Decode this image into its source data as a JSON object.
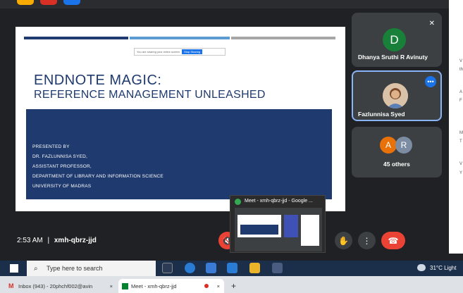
{
  "slide": {
    "share_text": "You are sharing your entire screen",
    "stop_label": "Stop Sharing",
    "title_line1": "ENDNOTE MAGIC:",
    "title_line2": "REFERENCE MANAGEMENT UNLEASHED",
    "presented_by": "PRESENTED BY",
    "presenter": "DR. FAZLUNNISA SYED,",
    "role": "ASSISTANT PROFESSOR,",
    "department": "DEPARTMENT OF LIBRARY AND INFORMATION SCIENCE",
    "university": "UNIVERSITY OF MADRAS"
  },
  "participants": {
    "p1_initial": "D",
    "p1_name": "Dhanya Sruthi R Avinuty",
    "p2_name": "Fazlunnisa Syed",
    "others_a": "A",
    "others_r": "R",
    "others_label": "45 others"
  },
  "side_panel_letters": [
    "V",
    "th",
    "A",
    "F",
    "M",
    "T",
    "V",
    "Y"
  ],
  "meeting": {
    "time": "2:53 AM",
    "separator": "|",
    "code": "xmh-qbrz-jjd"
  },
  "preview": {
    "title": "Meet - xmh-qbrz-jjd - Google ..."
  },
  "taskbar": {
    "search_placeholder": "Type here to search",
    "weather": "31°C  Light"
  },
  "browser_tabs": [
    {
      "label": "Inbox (943) - 20phchf002@avin",
      "close": "×"
    },
    {
      "label": "Meet - xmh-qbrz-jjd",
      "close": "×"
    }
  ],
  "new_tab": "+",
  "colors": {
    "slide_blue": "#1f3a6e",
    "end_call": "#ea4335",
    "avatar_d": "#188038"
  }
}
